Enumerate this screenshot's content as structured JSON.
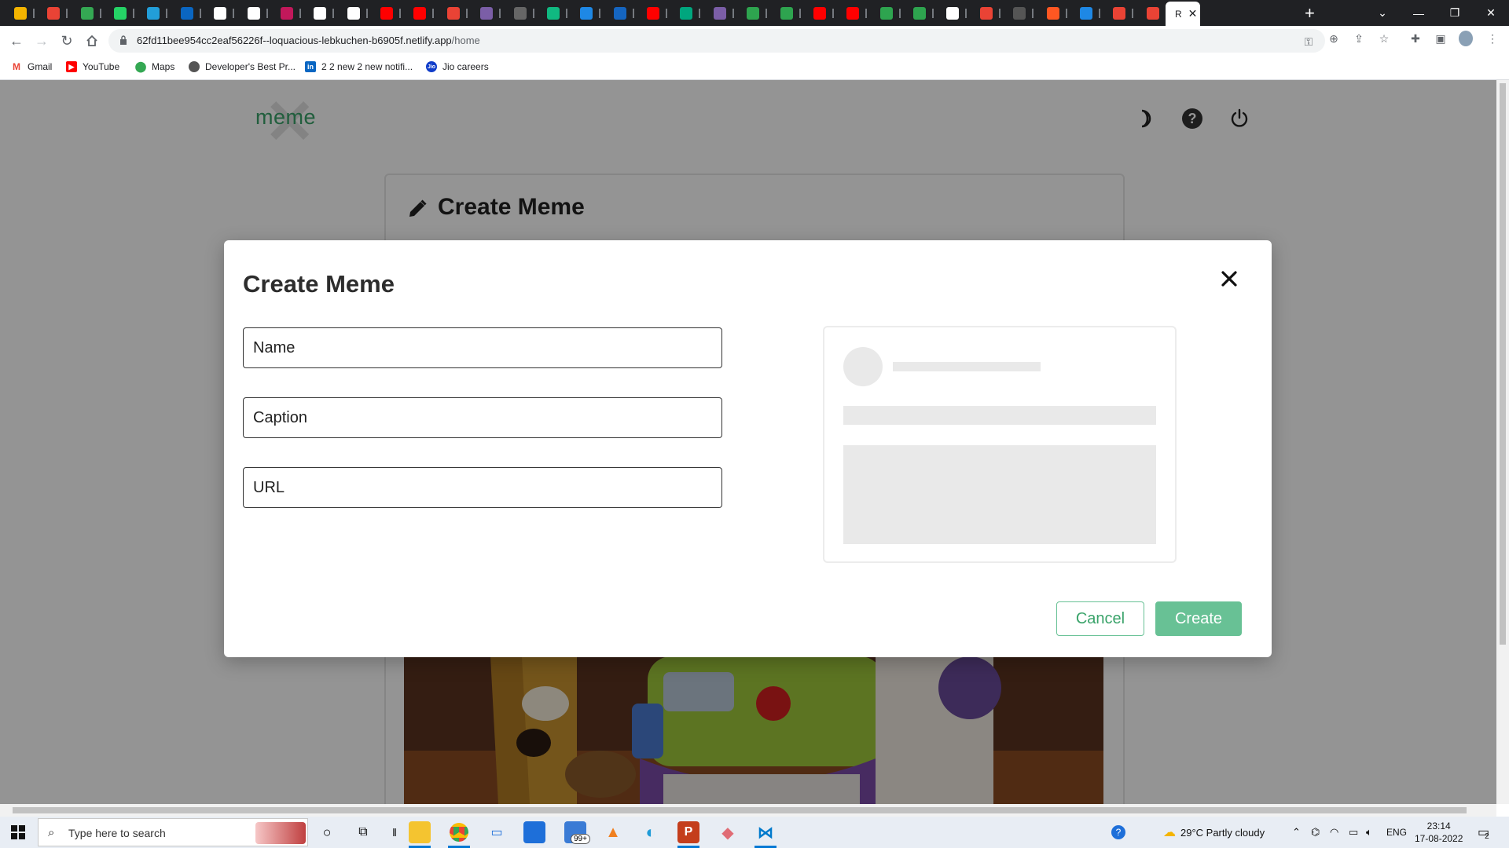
{
  "browser": {
    "active_tab_title": "R",
    "url_host": "62fd11bee954cc2eaf56226f--loquacious-lebkuchen-b6905f.netlify.app",
    "url_path": "/home",
    "bookmarks": [
      "Gmail",
      "YouTube",
      "Maps",
      "Developer's Best Pr...",
      "2 2 new 2 new notifi...",
      "Jio careers"
    ]
  },
  "app": {
    "logo_text": "meme",
    "card_title": "Create Meme"
  },
  "modal": {
    "title": "Create Meme",
    "fields": {
      "name_placeholder": "Name",
      "caption_placeholder": "Caption",
      "url_placeholder": "URL"
    },
    "cancel_label": "Cancel",
    "create_label": "Create"
  },
  "taskbar": {
    "search_placeholder": "Type here to search",
    "mail_badge": "99+",
    "weather": "29°C  Partly cloudy",
    "language": "ENG",
    "time": "23:14",
    "date": "17-08-2022",
    "notification_count": "2"
  },
  "colors": {
    "accent": "#68c195",
    "accent_text": "#3aa36a",
    "tabstrip": "#202124",
    "overlay": "rgba(0,0,0,0.42)"
  },
  "icons": {
    "header": [
      "moon-icon",
      "help-icon",
      "power-icon"
    ],
    "card": "pencil-icon",
    "modal_close": "close-icon"
  }
}
